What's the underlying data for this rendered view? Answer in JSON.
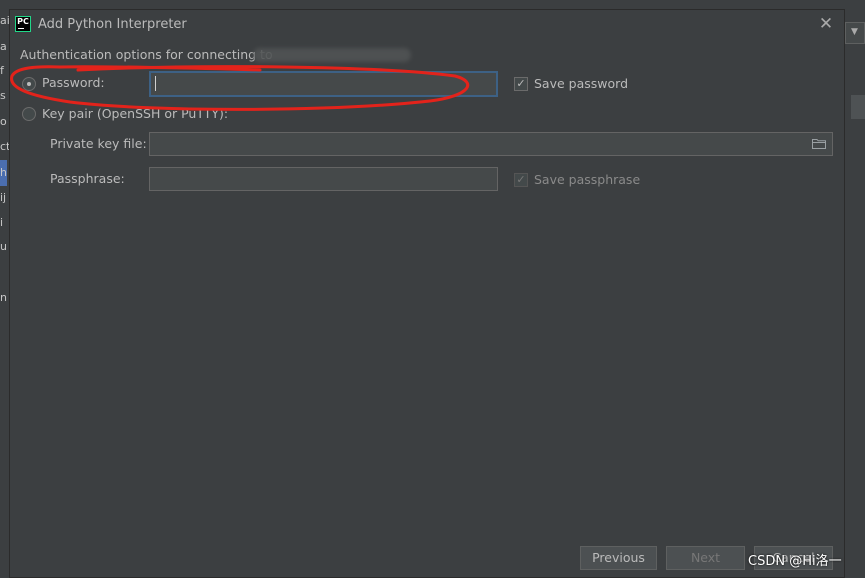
{
  "dialog": {
    "title": "Add Python Interpreter",
    "close_glyph": "✕",
    "description": "Authentication options for connecting to",
    "password_option": {
      "label": "Password:",
      "selected": true,
      "value": ""
    },
    "save_password": {
      "label": "Save password",
      "checked": true
    },
    "keypair_option": {
      "label": "Key pair (OpenSSH or PuTTY):",
      "selected": false
    },
    "private_key": {
      "label": "Private key file:",
      "value": ""
    },
    "passphrase": {
      "label": "Passphrase:",
      "value": ""
    },
    "save_passphrase": {
      "label": "Save passphrase",
      "checked": true,
      "enabled": false
    },
    "buttons": {
      "previous": "Previous",
      "next": "Next",
      "cancel": "Cancel"
    },
    "check_glyph": "✓"
  },
  "background": {
    "left_fragments": [
      "ai",
      "a",
      "f",
      "s",
      "o",
      "ct",
      "h",
      "ij",
      "i",
      "u",
      "n"
    ],
    "right_arrow_glyph": "▼"
  },
  "watermark": "CSDN @Hi洛一",
  "colors": {
    "annotation_stroke": "#e3231b",
    "focus_border": "#3d6185",
    "selection": "#4b6eaf"
  }
}
